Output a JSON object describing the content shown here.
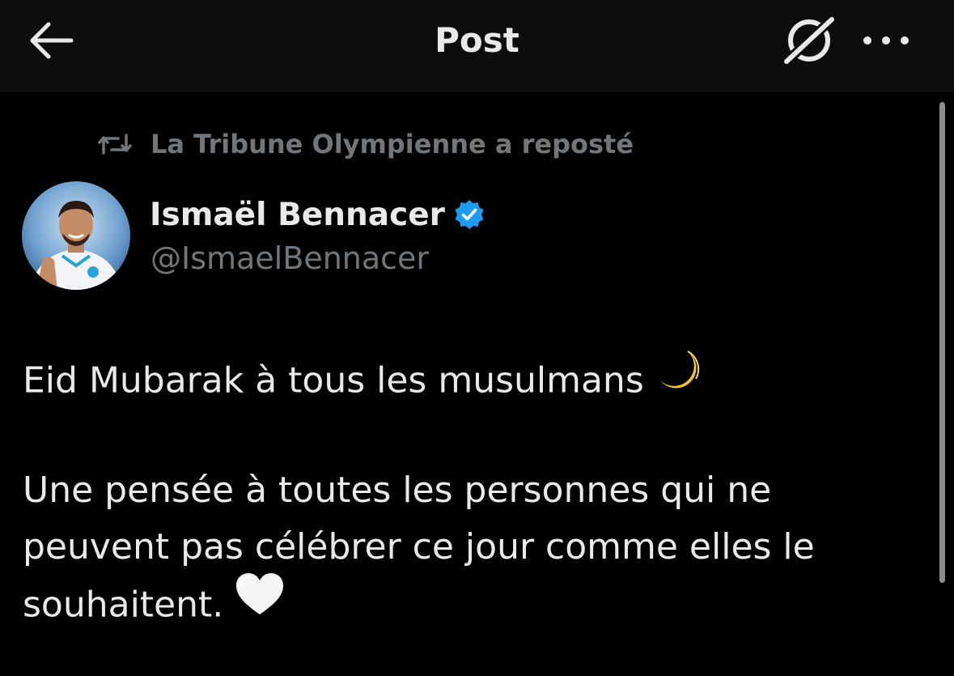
{
  "header": {
    "title": "Post",
    "back_icon": "arrow-left-icon",
    "grok_icon": "grok-icon",
    "more_icon": "more-horizontal-icon"
  },
  "repost": {
    "icon": "repost-icon",
    "text": "La Tribune Olympienne a reposté"
  },
  "author": {
    "name": "Ismaël Bennacer",
    "handle": "@IsmaelBennacer",
    "verified": true,
    "verified_color": "#1d9bf0"
  },
  "tweet": {
    "line1": "Eid Mubarak à tous les musulmans",
    "line1_emoji": "crescent-moon-emoji",
    "line2": "Une pensée à toutes les personnes qui ne",
    "line3": "peuvent pas célébrer ce jour comme elles le",
    "line4": "souhaitent.",
    "line4_emoji": "white-heart-emoji"
  },
  "colors": {
    "background": "#000000",
    "header_background": "#0d0d0d",
    "text_primary": "#e7e9ea",
    "text_secondary": "#71767b",
    "accent": "#1d9bf0"
  }
}
